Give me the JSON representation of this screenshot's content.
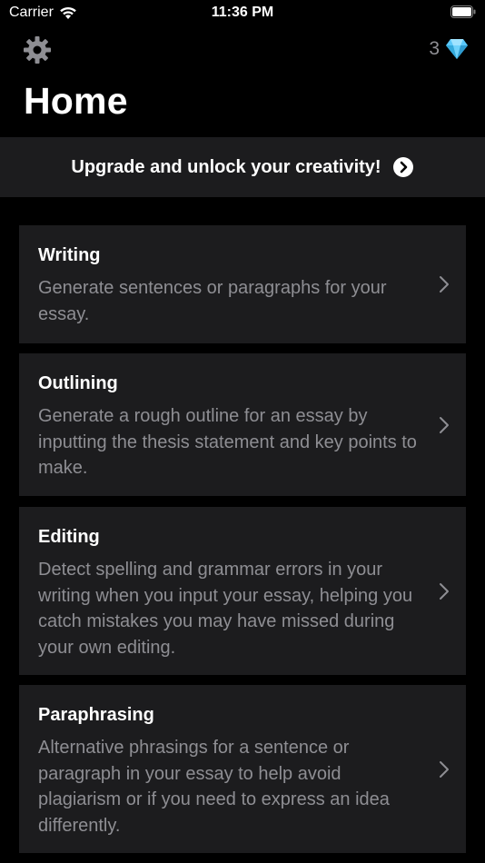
{
  "status_bar": {
    "carrier": "Carrier",
    "time": "11:36 PM"
  },
  "nav": {
    "credits_count": "3"
  },
  "page": {
    "title": "Home"
  },
  "upgrade": {
    "label": "Upgrade and unlock your creativity!"
  },
  "features": [
    {
      "title": "Writing",
      "description": "Generate sentences or paragraphs for your essay."
    },
    {
      "title": "Outlining",
      "description": "Generate a rough outline for an essay by inputting the thesis statement and key points to make."
    },
    {
      "title": "Editing",
      "description": "Detect spelling and grammar errors in your writing when you input your essay, helping you catch mistakes you may have missed during your own editing."
    },
    {
      "title": "Paraphrasing",
      "description": "Alternative phrasings for a sentence or paragraph in your essay to help avoid plagiarism or if you need to express an idea differently."
    }
  ],
  "colors": {
    "background": "#000000",
    "card": "#1c1c1e",
    "secondary_text": "#8e8e93",
    "gem": "#5ac8fa"
  },
  "icons": [
    "wifi-icon",
    "battery-icon",
    "gear-icon",
    "gem-icon",
    "arrow-right-circle-icon",
    "chevron-right-icon"
  ]
}
